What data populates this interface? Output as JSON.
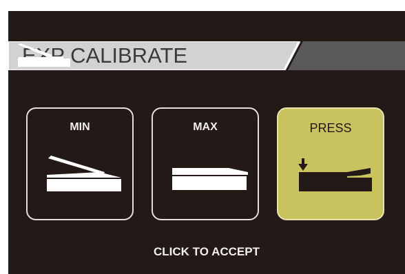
{
  "screen": {
    "title": "EXP CALIBRATE",
    "footer": "CLICK TO ACCEPT"
  },
  "buttons": [
    {
      "id": "min",
      "label": "MIN",
      "state": "normal",
      "icon": "pedal-heel-down-icon"
    },
    {
      "id": "max",
      "label": "MAX",
      "state": "normal",
      "icon": "pedal-toe-down-icon"
    },
    {
      "id": "press",
      "label": "PRESS",
      "state": "selected",
      "icon": "pedal-press-icon"
    }
  ],
  "colors": {
    "background": "#231917",
    "title_bar": "#d2d2d2",
    "title_dark": "#5a5a5a",
    "selected": "#c8c25f",
    "text": "#f2f0ee"
  }
}
